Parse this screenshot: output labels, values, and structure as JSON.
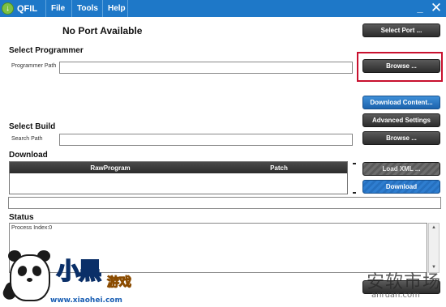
{
  "window": {
    "app_name": "QFIL",
    "logo_glyph": "↓",
    "minimize_glyph": "_",
    "close_glyph": "✕"
  },
  "menu": {
    "file": "File",
    "tools": "Tools",
    "help": "Help"
  },
  "port": {
    "status": "No Port Available",
    "select_port_label": "Select Port ..."
  },
  "programmer": {
    "section_title": "Select Programmer",
    "path_label": "Programmer Path",
    "path_value": "",
    "browse_label": "Browse ..."
  },
  "build": {
    "download_content_label": "Download Content...",
    "advanced_settings_label": "Advanced Settings",
    "section_title": "Select Build",
    "search_label": "Search Path",
    "search_value": "",
    "browse_label": "Browse ..."
  },
  "download": {
    "section_title": "Download",
    "columns": [
      "RawProgram",
      "Patch"
    ],
    "rows": [],
    "load_xml_label": "Load XML ...",
    "download_label": "Download",
    "dash": "-"
  },
  "status": {
    "section_title": "Status",
    "log_text": "Process Index:0",
    "scroll_up_glyph": "▲",
    "scroll_down_glyph": "▼"
  },
  "watermark": {
    "logo_text": "小黑",
    "logo_small": "游戏",
    "url": "www.xiaohei.com",
    "right_cn": "安软市场",
    "right_url": "anruan.com"
  },
  "colors": {
    "titlebar": "#1e78c8",
    "accent_blue": "#2670bf",
    "dark_button": "#2c2c2c",
    "highlight": "#c8102e"
  }
}
